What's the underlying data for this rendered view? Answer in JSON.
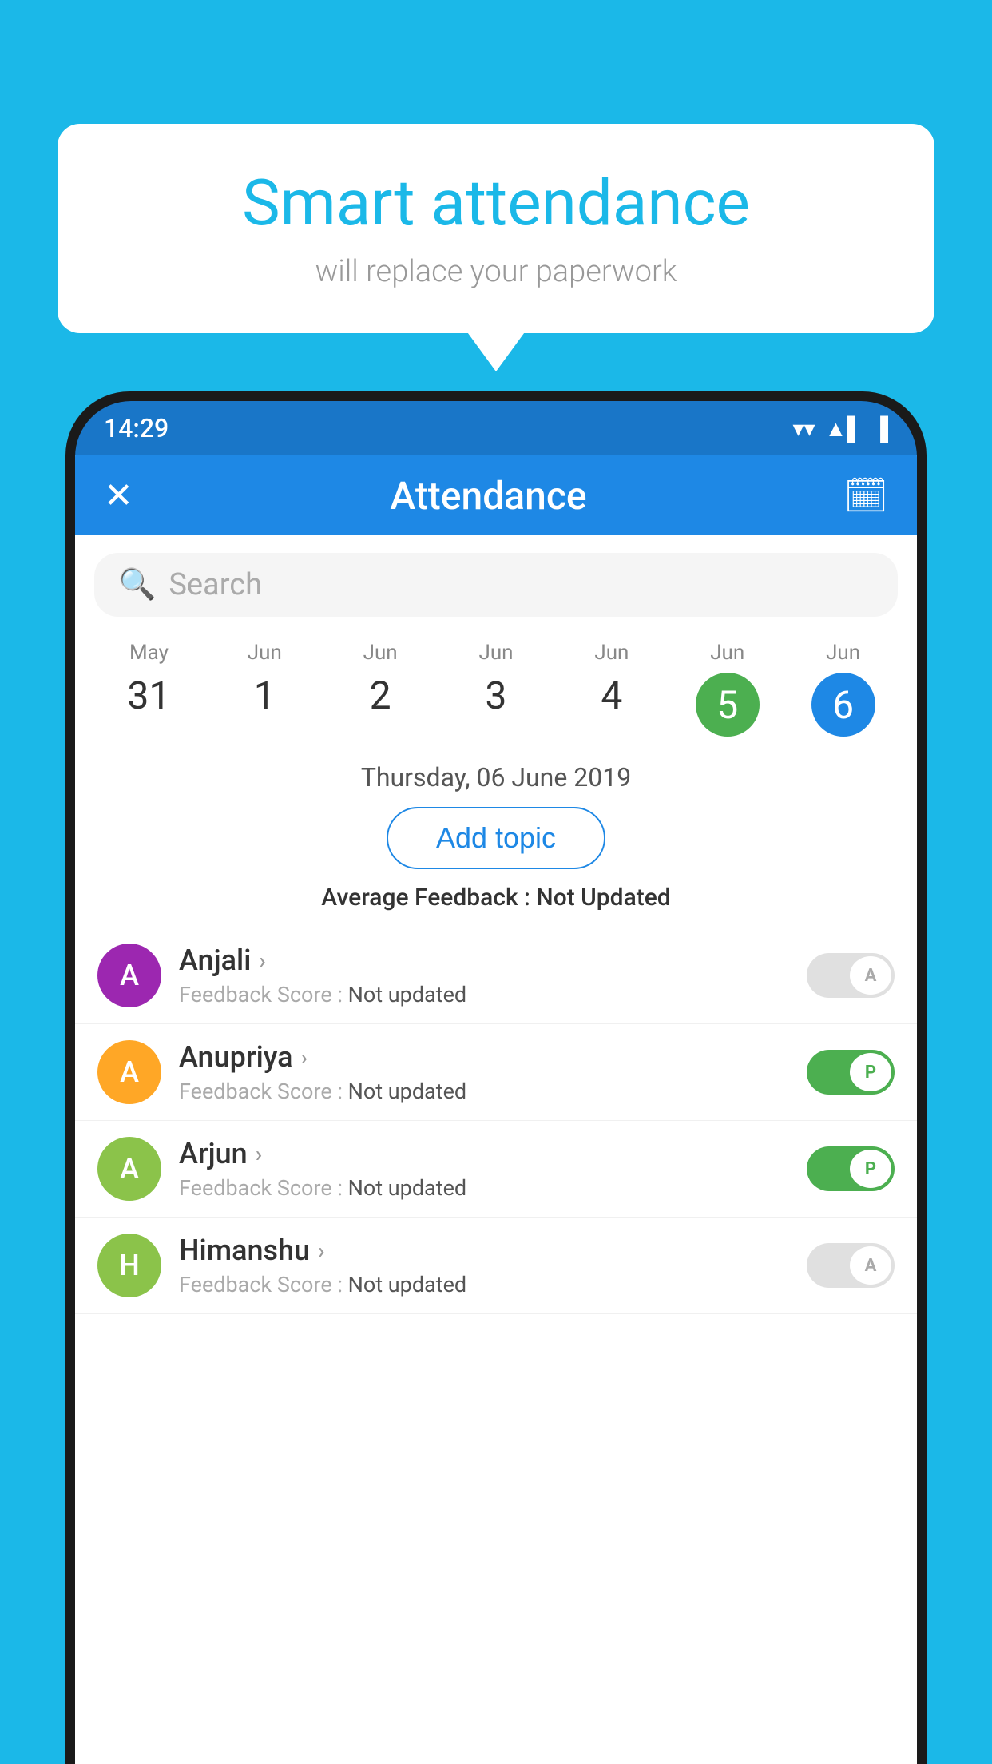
{
  "background_color": "#1BB8E8",
  "speech_bubble": {
    "heading": "Smart attendance",
    "subtext": "will replace your paperwork"
  },
  "status_bar": {
    "time": "14:29",
    "wifi": "▾",
    "signal": "▲",
    "battery": "▌"
  },
  "app_header": {
    "close_icon": "✕",
    "title": "Attendance",
    "calendar_icon": "📅"
  },
  "search": {
    "placeholder": "Search"
  },
  "calendar": {
    "days": [
      {
        "month": "May",
        "date": "31",
        "style": "normal"
      },
      {
        "month": "Jun",
        "date": "1",
        "style": "normal"
      },
      {
        "month": "Jun",
        "date": "2",
        "style": "normal"
      },
      {
        "month": "Jun",
        "date": "3",
        "style": "normal"
      },
      {
        "month": "Jun",
        "date": "4",
        "style": "normal"
      },
      {
        "month": "Jun",
        "date": "5",
        "style": "green"
      },
      {
        "month": "Jun",
        "date": "6",
        "style": "blue"
      }
    ]
  },
  "selected_date_label": "Thursday, 06 June 2019",
  "add_topic_button": "Add topic",
  "average_feedback": {
    "label": "Average Feedback : ",
    "value": "Not Updated"
  },
  "students": [
    {
      "name": "Anjali",
      "avatar_letter": "A",
      "avatar_color": "#9C27B0",
      "feedback_label": "Feedback Score : ",
      "feedback_value": "Not updated",
      "toggle": "off",
      "toggle_label": "A"
    },
    {
      "name": "Anupriya",
      "avatar_letter": "A",
      "avatar_color": "#FFA726",
      "feedback_label": "Feedback Score : ",
      "feedback_value": "Not updated",
      "toggle": "on",
      "toggle_label": "P"
    },
    {
      "name": "Arjun",
      "avatar_letter": "A",
      "avatar_color": "#8BC34A",
      "feedback_label": "Feedback Score : ",
      "feedback_value": "Not updated",
      "toggle": "on",
      "toggle_label": "P"
    },
    {
      "name": "Himanshu",
      "avatar_letter": "H",
      "avatar_color": "#8BC34A",
      "feedback_label": "Feedback Score : ",
      "feedback_value": "Not updated",
      "toggle": "off",
      "toggle_label": "A"
    }
  ]
}
